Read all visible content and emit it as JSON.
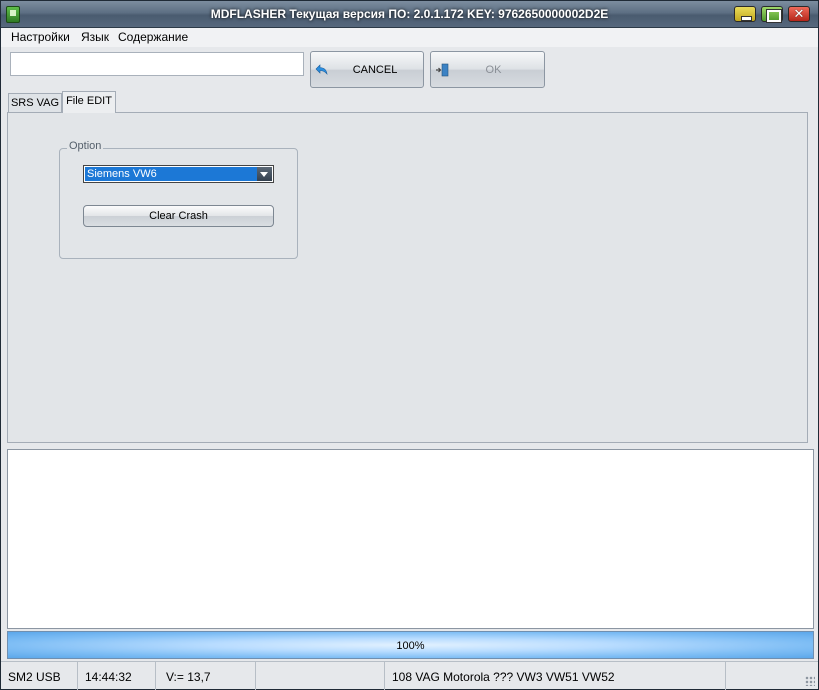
{
  "window": {
    "title": "MDFLASHER  Текущая версия ПО: 2.0.1.172  KEY: 9762650000002D2E",
    "close_glyph": "✕"
  },
  "menu": {
    "items": [
      {
        "label": "Настройки"
      },
      {
        "label": "Язык"
      },
      {
        "label": "Содержание"
      }
    ]
  },
  "toolbar": {
    "input_value": "",
    "cancel_label": "CANCEL",
    "ok_label": "OK",
    "cancel_icon": "undo-arrow-icon",
    "ok_icon": "door-enter-icon"
  },
  "tabs": [
    {
      "label": "SRS VAG",
      "active": false
    },
    {
      "label": "File EDIT",
      "active": true
    }
  ],
  "option_group": {
    "legend": "Option",
    "selected": "Siemens VW6",
    "clear_button": "Clear Crash"
  },
  "log": {
    "content": ""
  },
  "progress": {
    "value_percent": 100,
    "label": "100%"
  },
  "status": {
    "interface": "SM2 USB",
    "time": "14:44:32",
    "voltage": "V:= 13,7",
    "empty": "",
    "info": "108 VAG Motorola ??? VW3 VW51 VW52"
  },
  "colors": {
    "selection": "#1c78d6",
    "progress_fill": "#7fbef5",
    "accent_icon": "#2a8ee0"
  }
}
